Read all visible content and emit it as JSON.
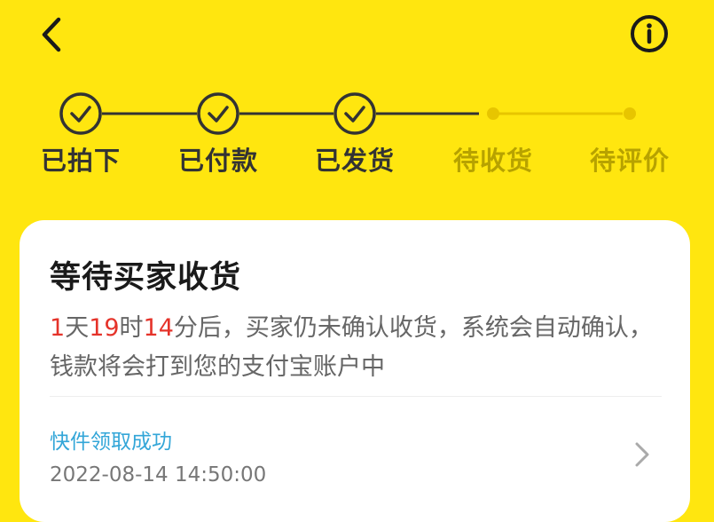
{
  "header": {
    "back_icon": "chevron-left-icon",
    "info_icon": "info-circle-icon"
  },
  "progress": {
    "steps": [
      {
        "label": "已拍下",
        "status": "done"
      },
      {
        "label": "已付款",
        "status": "done"
      },
      {
        "label": "已发货",
        "status": "done"
      },
      {
        "label": "待收货",
        "status": "pending"
      },
      {
        "label": "待评价",
        "status": "pending"
      }
    ]
  },
  "order_status": {
    "title": "等待买家收货",
    "countdown": {
      "days": "1",
      "day_unit": "天",
      "hours": "19",
      "hour_unit": "时",
      "minutes": "14",
      "minute_unit": "分"
    },
    "description_tail": "后，买家仍未确认收货，系统会自动确认，钱款将会打到您的支付宝账户中"
  },
  "logistics": {
    "status": "快件领取成功",
    "time": "2022-08-14 14:50:00",
    "arrow_icon": "chevron-right-icon"
  },
  "colors": {
    "background": "#FFE60F",
    "done": "#333333",
    "pending": "#B7A200",
    "countdown": "#E5332A",
    "link": "#33A6D8"
  }
}
